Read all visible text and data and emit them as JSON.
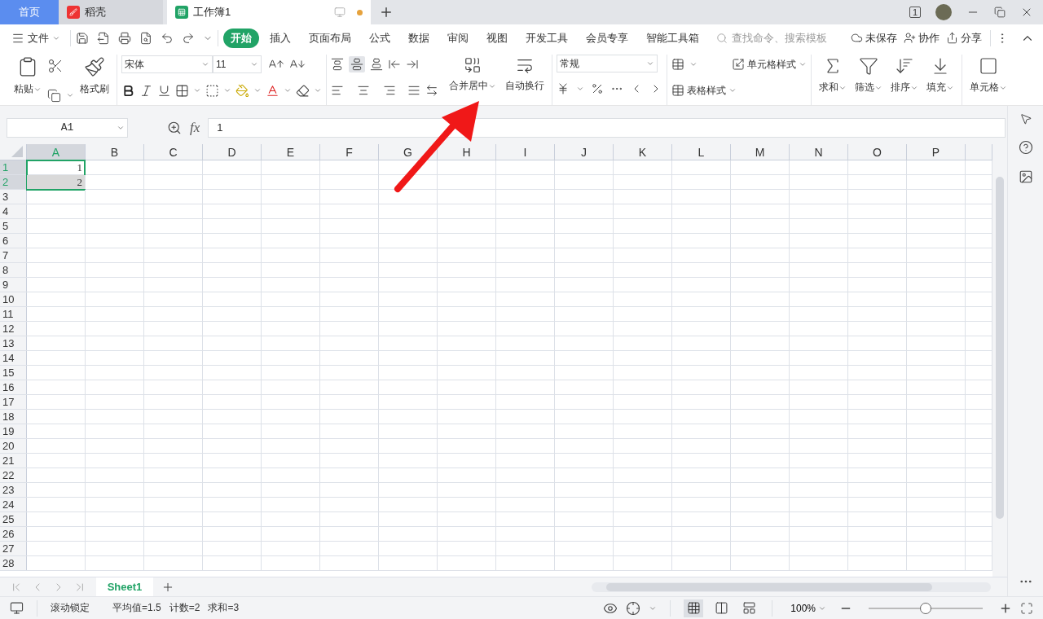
{
  "title_bar": {
    "tabs": [
      {
        "label": "首页",
        "kind": "home",
        "selected": false
      },
      {
        "label": "稻壳",
        "kind": "docer",
        "selected": false
      },
      {
        "label": "工作簿1",
        "kind": "sheet",
        "selected": true
      }
    ],
    "window_count": "1"
  },
  "menu_bar": {
    "file": "文件",
    "tabs": [
      {
        "label": "开始",
        "selected": true
      },
      {
        "label": "插入",
        "selected": false
      },
      {
        "label": "页面布局",
        "selected": false
      },
      {
        "label": "公式",
        "selected": false
      },
      {
        "label": "数据",
        "selected": false
      },
      {
        "label": "审阅",
        "selected": false
      },
      {
        "label": "视图",
        "selected": false
      },
      {
        "label": "开发工具",
        "selected": false
      },
      {
        "label": "会员专享",
        "selected": false
      },
      {
        "label": "智能工具箱",
        "selected": false
      }
    ],
    "search": {
      "placeholder": "查找命令、搜索模板"
    },
    "actions": [
      "未保存",
      "协作",
      "分享"
    ]
  },
  "ribbon": {
    "paste": "粘贴",
    "format_painter": "格式刷",
    "font": "宋体",
    "font_size": "11",
    "merge_center": "合并居中",
    "wrap_text": "自动换行",
    "number_format": "常规",
    "cell_style": "单元格样式",
    "table_style": "表格样式",
    "tools": [
      "求和",
      "筛选",
      "排序",
      "填充"
    ],
    "cells": "单元格"
  },
  "formula_bar": {
    "name_box": "A1",
    "fx_label": "fx",
    "formula": "1"
  },
  "grid": {
    "columns": [
      {
        "label": "A",
        "selected": true
      },
      {
        "label": "B",
        "selected": false
      },
      {
        "label": "C",
        "selected": false
      },
      {
        "label": "D",
        "selected": false
      },
      {
        "label": "E",
        "selected": false
      },
      {
        "label": "F",
        "selected": false
      },
      {
        "label": "G",
        "selected": false
      },
      {
        "label": "H",
        "selected": false
      },
      {
        "label": "I",
        "selected": false
      },
      {
        "label": "J",
        "selected": false
      },
      {
        "label": "K",
        "selected": false
      },
      {
        "label": "L",
        "selected": false
      },
      {
        "label": "M",
        "selected": false
      },
      {
        "label": "N",
        "selected": false
      },
      {
        "label": "O",
        "selected": false
      },
      {
        "label": "P",
        "selected": false
      }
    ],
    "rows": [
      {
        "label": "1",
        "selected": true,
        "cells": [
          {
            "text": "1",
            "active": true
          }
        ]
      },
      {
        "label": "2",
        "selected": true,
        "cells": [
          {
            "text": "2",
            "active": false
          }
        ]
      },
      {
        "label": "3",
        "selected": false,
        "cells": []
      },
      {
        "label": "4",
        "selected": false,
        "cells": []
      },
      {
        "label": "5",
        "selected": false,
        "cells": []
      },
      {
        "label": "6",
        "selected": false,
        "cells": []
      },
      {
        "label": "7",
        "selected": false,
        "cells": []
      },
      {
        "label": "8",
        "selected": false,
        "cells": []
      },
      {
        "label": "9",
        "selected": false,
        "cells": []
      },
      {
        "label": "10",
        "selected": false,
        "cells": []
      },
      {
        "label": "11",
        "selected": false,
        "cells": []
      },
      {
        "label": "12",
        "selected": false,
        "cells": []
      },
      {
        "label": "13",
        "selected": false,
        "cells": []
      },
      {
        "label": "14",
        "selected": false,
        "cells": []
      },
      {
        "label": "15",
        "selected": false,
        "cells": []
      },
      {
        "label": "16",
        "selected": false,
        "cells": []
      },
      {
        "label": "17",
        "selected": false,
        "cells": []
      },
      {
        "label": "18",
        "selected": false,
        "cells": []
      },
      {
        "label": "19",
        "selected": false,
        "cells": []
      },
      {
        "label": "20",
        "selected": false,
        "cells": []
      },
      {
        "label": "21",
        "selected": false,
        "cells": []
      },
      {
        "label": "22",
        "selected": false,
        "cells": []
      },
      {
        "label": "23",
        "selected": false,
        "cells": []
      },
      {
        "label": "24",
        "selected": false,
        "cells": []
      },
      {
        "label": "25",
        "selected": false,
        "cells": []
      },
      {
        "label": "26",
        "selected": false,
        "cells": []
      },
      {
        "label": "27",
        "selected": false,
        "cells": []
      },
      {
        "label": "28",
        "selected": false,
        "cells": []
      }
    ]
  },
  "sheet_tabs": [
    {
      "label": "Sheet1",
      "selected": true
    }
  ],
  "status_bar": {
    "scroll_lock": "滚动锁定",
    "stats": [
      "平均值=1.5",
      "计数=2",
      "求和=3"
    ],
    "view_modes": [
      {
        "selected": true
      },
      {
        "selected": false
      },
      {
        "selected": false
      }
    ],
    "zoom": "100%",
    "zoom_slider": {
      "level": 0.5
    }
  }
}
